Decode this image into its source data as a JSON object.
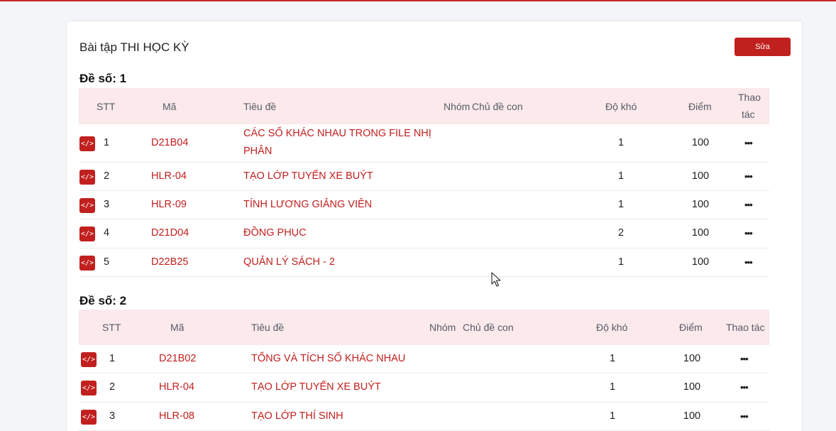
{
  "card_title": "Bài tập THI HỌC KỲ",
  "edit_button": "Sửa",
  "sections": [
    {
      "title": "Đề số: 1",
      "headers": {
        "stt": "STT",
        "ma": "Mã",
        "tieude": "Tiêu đề",
        "nhom": "Nhóm",
        "chude": "Chủ đề con",
        "dokho": "Độ khó",
        "diem": "Điểm",
        "thaotac_line1": "Thao",
        "thaotac_line2": "tác"
      },
      "rows": [
        {
          "stt": "1",
          "ma": "D21B04",
          "tieude_line1": "CÁC SỐ KHÁC NHAU TRONG FILE NHỊ",
          "tieude_line2": "PHÂN",
          "dokho": "1",
          "diem": "100"
        },
        {
          "stt": "2",
          "ma": "HLR-04",
          "tieude_line1": "TẠO LỚP TUYẾN XE BUÝT",
          "dokho": "1",
          "diem": "100"
        },
        {
          "stt": "3",
          "ma": "HLR-09",
          "tieude_line1": "TÍNH LƯƠNG GIẢNG VIÊN",
          "dokho": "1",
          "diem": "100"
        },
        {
          "stt": "4",
          "ma": "D21D04",
          "tieude_line1": "ĐỒNG PHỤC",
          "dokho": "2",
          "diem": "100"
        },
        {
          "stt": "5",
          "ma": "D22B25",
          "tieude_line1": "QUẢN LÝ SÁCH - 2",
          "dokho": "1",
          "diem": "100"
        }
      ]
    },
    {
      "title": "Đề số: 2",
      "headers": {
        "stt": "STT",
        "ma": "Mã",
        "tieude": "Tiêu đề",
        "nhom": "Nhóm",
        "chude": "Chủ đề con",
        "dokho": "Độ khó",
        "diem": "Điểm",
        "thaotac": "Thao tác"
      },
      "rows": [
        {
          "stt": "1",
          "ma": "D21B02",
          "tieude_line1": "TỔNG VÀ TÍCH SỐ KHÁC NHAU",
          "dokho": "1",
          "diem": "100"
        },
        {
          "stt": "2",
          "ma": "HLR-04",
          "tieude_line1": "TẠO LỚP TUYẾN XE BUÝT",
          "dokho": "1",
          "diem": "100"
        },
        {
          "stt": "3",
          "ma": "HLR-08",
          "tieude_line1": "TẠO LỚP THÍ SINH",
          "dokho": "1",
          "diem": "100"
        }
      ]
    }
  ],
  "icons": {
    "code": "code-icon",
    "more": "more-dots-icon"
  },
  "more_glyph": "•••",
  "code_glyph": "</>",
  "colors": {
    "accent": "#c0201e",
    "header_bg": "#fbe9eb"
  }
}
